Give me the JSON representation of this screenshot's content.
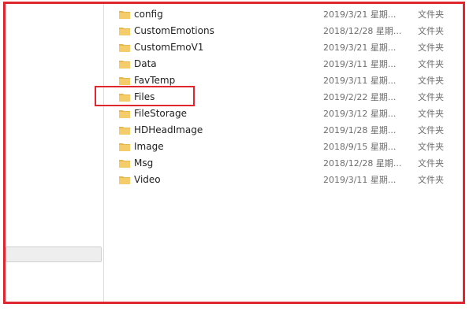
{
  "colors": {
    "highlight": "#e0262e",
    "folder": "#e8b64a"
  },
  "files": [
    {
      "name": "config",
      "date": "2019/3/21 星期...",
      "type": "文件夹"
    },
    {
      "name": "CustomEmotions",
      "date": "2018/12/28 星期...",
      "type": "文件夹"
    },
    {
      "name": "CustomEmoV1",
      "date": "2019/3/21 星期...",
      "type": "文件夹"
    },
    {
      "name": "Data",
      "date": "2019/3/11 星期...",
      "type": "文件夹"
    },
    {
      "name": "FavTemp",
      "date": "2019/3/11 星期...",
      "type": "文件夹"
    },
    {
      "name": "Files",
      "date": "2019/2/22 星期...",
      "type": "文件夹"
    },
    {
      "name": "FileStorage",
      "date": "2019/3/12 星期...",
      "type": "文件夹"
    },
    {
      "name": "HDHeadImage",
      "date": "2019/1/28 星期...",
      "type": "文件夹"
    },
    {
      "name": "Image",
      "date": "2018/9/15 星期...",
      "type": "文件夹"
    },
    {
      "name": "Msg",
      "date": "2018/12/28 星期...",
      "type": "文件夹"
    },
    {
      "name": "Video",
      "date": "2019/3/11 星期...",
      "type": "文件夹"
    }
  ]
}
